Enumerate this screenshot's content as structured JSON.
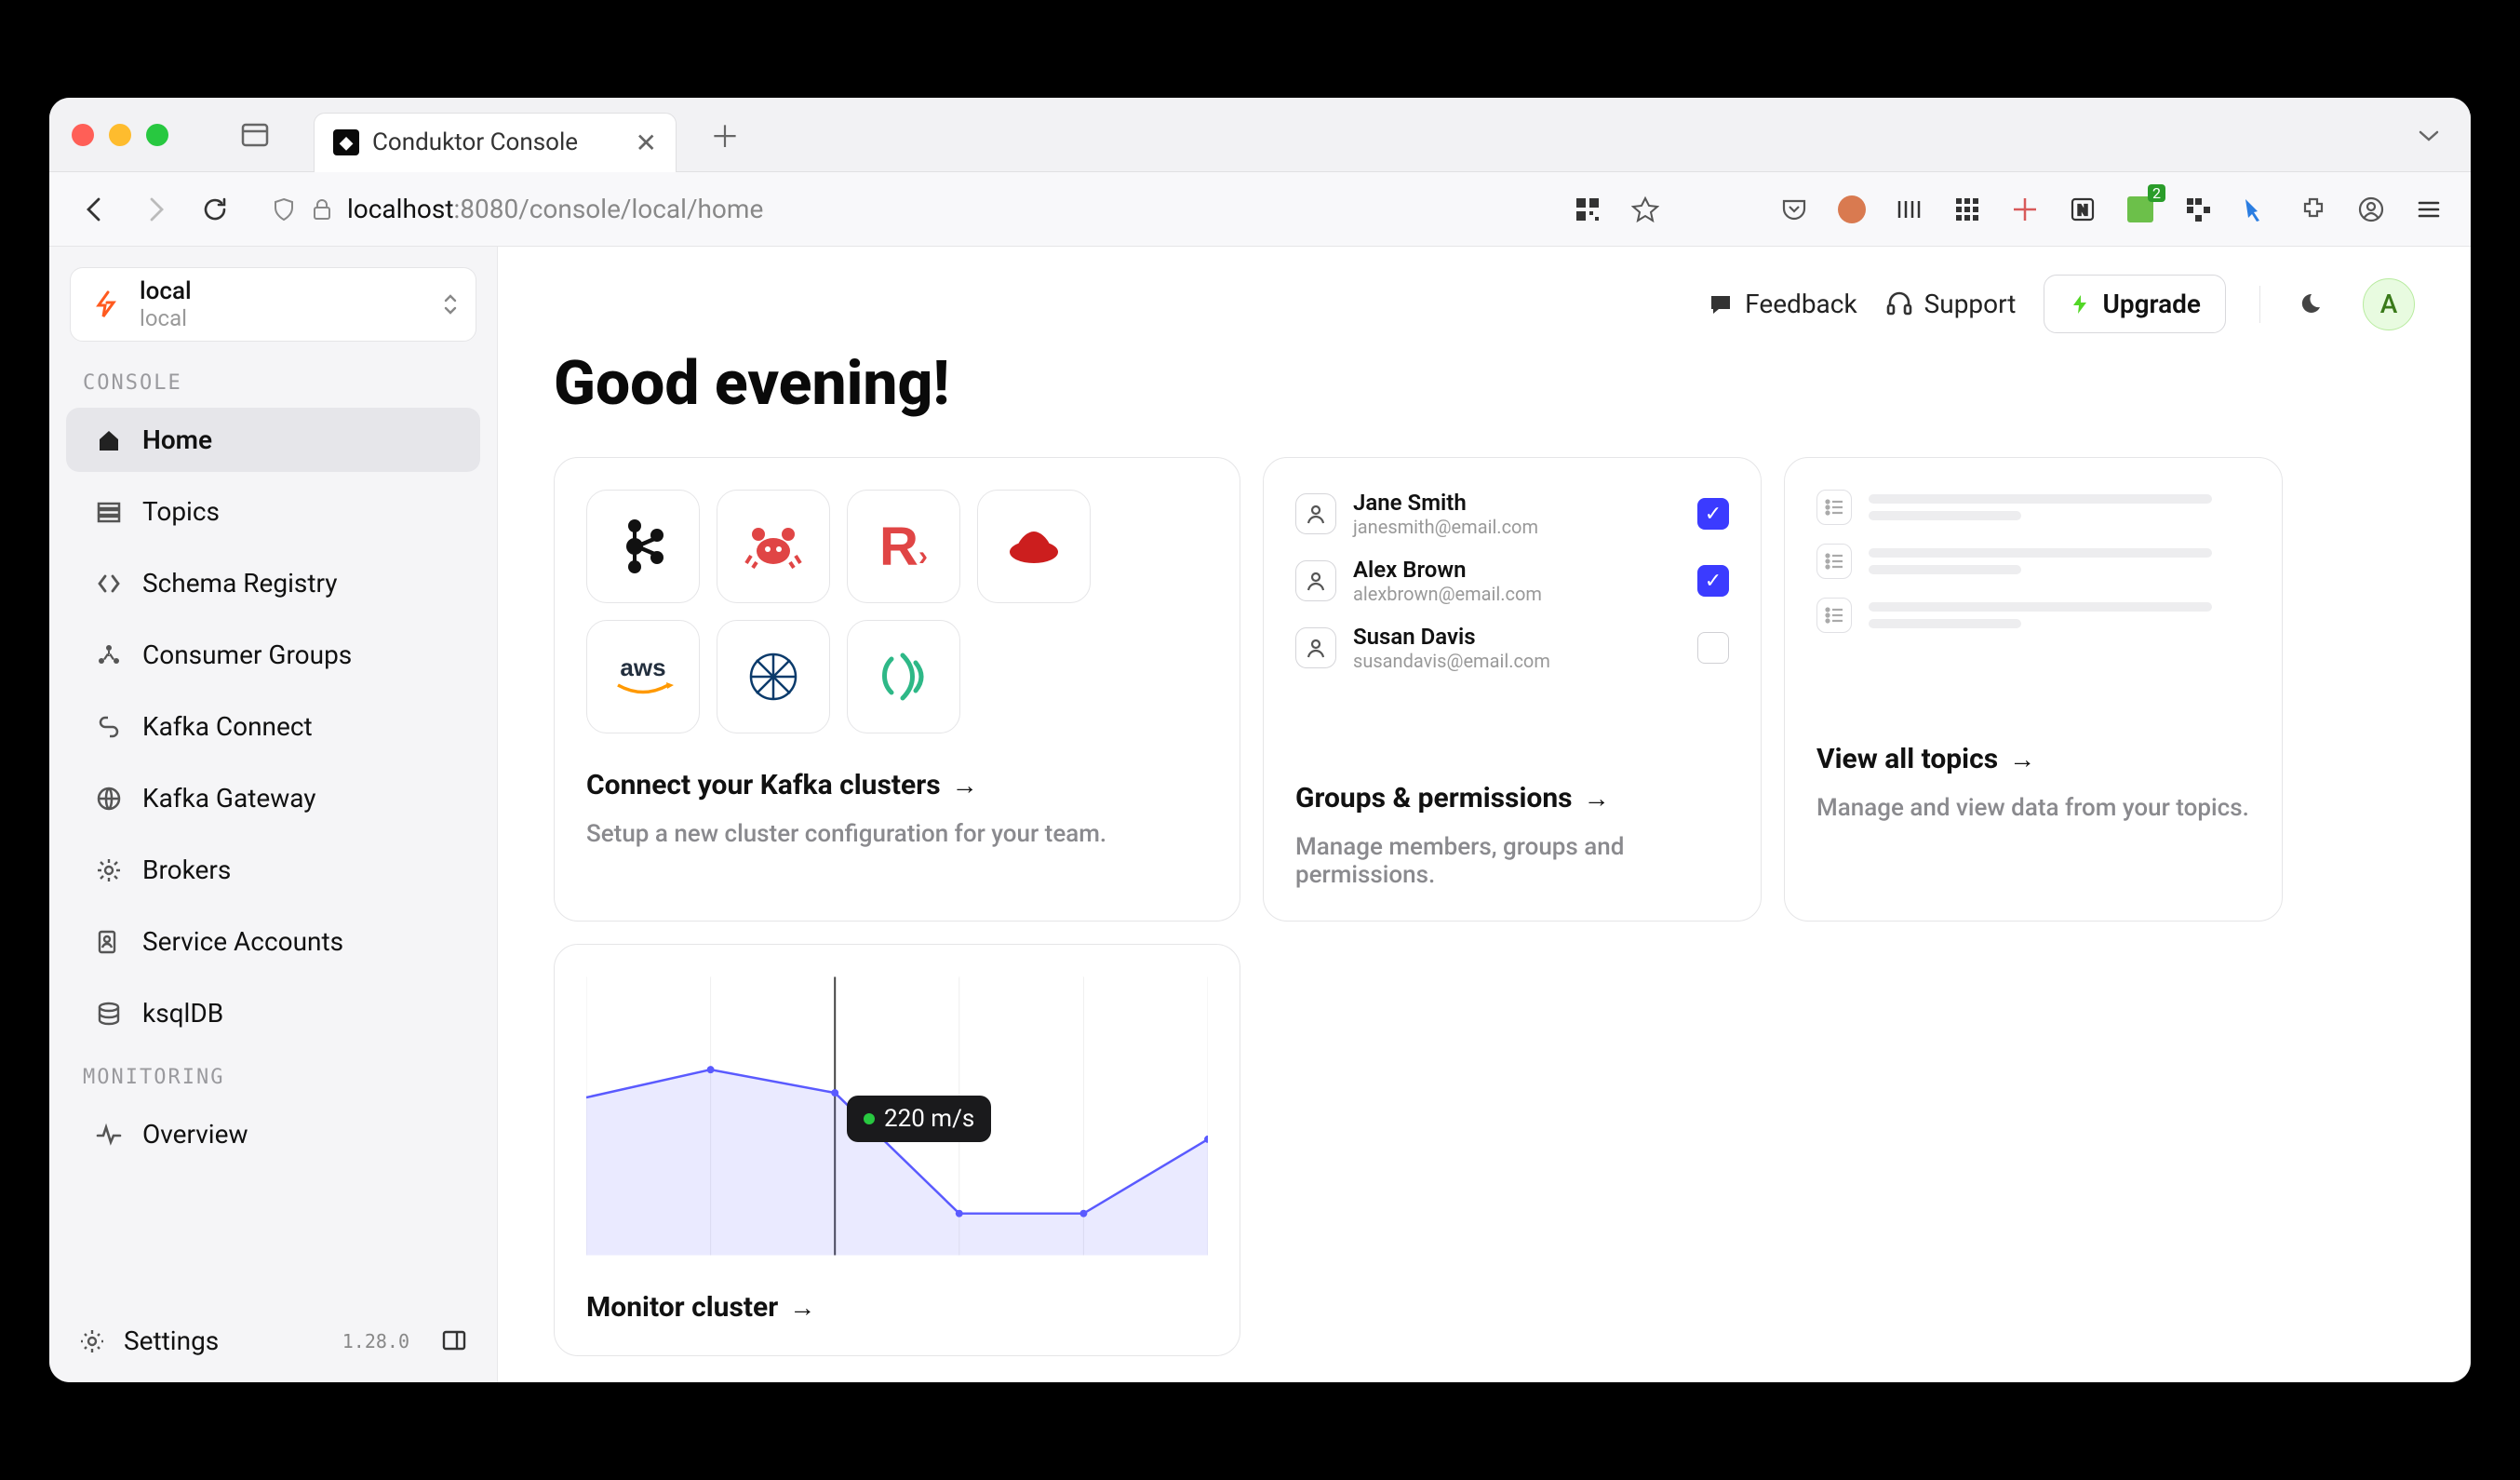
{
  "browser": {
    "tab_title": "Conduktor Console",
    "url_host": "localhost",
    "url_path": ":8080/console/local/home"
  },
  "cluster_picker": {
    "name": "local",
    "sub": "local"
  },
  "sidebar": {
    "section_console": "CONSOLE",
    "section_monitoring": "MONITORING",
    "items": {
      "home": "Home",
      "topics": "Topics",
      "schema_registry": "Schema Registry",
      "consumer_groups": "Consumer Groups",
      "kafka_connect": "Kafka Connect",
      "kafka_gateway": "Kafka Gateway",
      "brokers": "Brokers",
      "service_accounts": "Service Accounts",
      "ksqldb": "ksqlDB",
      "overview": "Overview"
    },
    "settings": "Settings",
    "version": "1.28.0"
  },
  "header": {
    "feedback": "Feedback",
    "support": "Support",
    "upgrade": "Upgrade",
    "avatar_initial": "A"
  },
  "greeting": "Good evening!",
  "cards": {
    "connect": {
      "title": "Connect your Kafka clusters",
      "sub": "Setup a new cluster configuration for your team.",
      "connectors": [
        "kafka",
        "crab",
        "redpanda",
        "redhat",
        "aws",
        "confluent",
        "upstash"
      ]
    },
    "groups": {
      "title": "Groups & permissions",
      "sub": "Manage members, groups and permissions.",
      "users": [
        {
          "name": "Jane Smith",
          "email": "janesmith@email.com",
          "checked": true
        },
        {
          "name": "Alex Brown",
          "email": "alexbrown@email.com",
          "checked": true
        },
        {
          "name": "Susan Davis",
          "email": "susandavis@email.com",
          "checked": false
        }
      ]
    },
    "topics": {
      "title": "View all topics",
      "sub": "Manage and view data from your topics."
    },
    "monitor": {
      "title": "Monitor cluster",
      "tooltip": "220 m/s"
    }
  },
  "chart_data": {
    "type": "line",
    "x": [
      0,
      1,
      2,
      3,
      4,
      5
    ],
    "values": [
      200,
      240,
      210,
      135,
      135,
      180
    ],
    "tooltip_value": "220 m/s",
    "xlabel": "",
    "ylabel": "",
    "ylim": [
      0,
      260
    ]
  }
}
